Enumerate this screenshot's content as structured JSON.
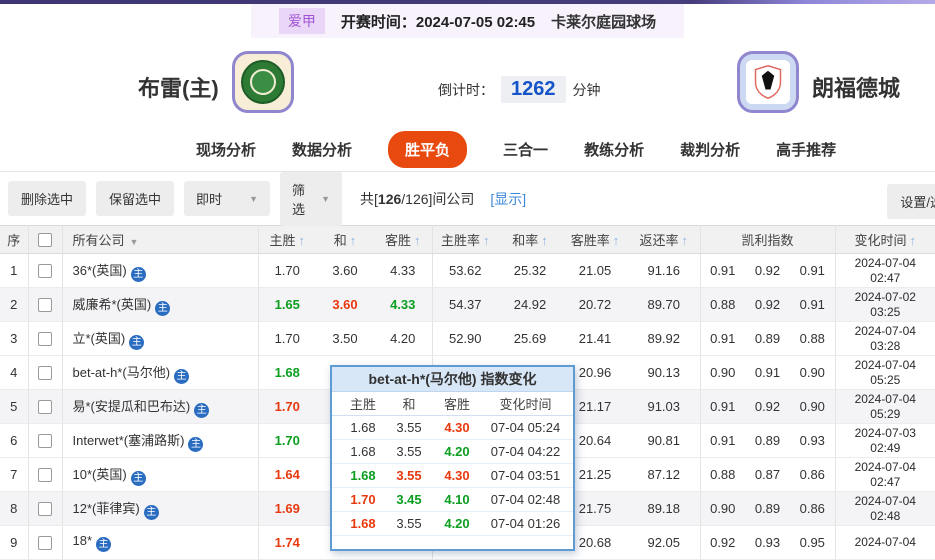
{
  "topbar": {
    "league": "爱甲",
    "kickoff": "开赛时间：2024-07-05 02:45",
    "venue": "卡莱尔庭园球场"
  },
  "header": {
    "home_team": "布雷(主)",
    "countdown_label": "倒计时：",
    "countdown_value": "1262",
    "countdown_unit": "分钟",
    "away_team": "朗福德城"
  },
  "nav": {
    "tabs": [
      {
        "id": "live",
        "label": "现场分析",
        "active": false
      },
      {
        "id": "data",
        "label": "数据分析",
        "active": false
      },
      {
        "id": "wdl",
        "label": "胜平负",
        "active": true
      },
      {
        "id": "three-in-one",
        "label": "三合一",
        "active": false
      },
      {
        "id": "coach",
        "label": "教练分析",
        "active": false
      },
      {
        "id": "referee",
        "label": "裁判分析",
        "active": false
      },
      {
        "id": "expert",
        "label": "高手推荐",
        "active": false
      }
    ]
  },
  "toolbar": {
    "delete_selected": "删除选中",
    "keep_selected": "保留选中",
    "instant_dropdown": "即时",
    "filter_dropdown": "筛选",
    "count_prefix": "共[",
    "count_bold": "126",
    "count_suffix": "/126]间公司",
    "show_link": "[显示]",
    "settings_button": "设置/选择"
  },
  "icons": {
    "sort_asc": "↑",
    "caret_down": "▼",
    "company_badge": "主"
  },
  "colors": {
    "accent_bar": "#3d3673",
    "active_tab": "#e8490f",
    "odds_rise_red": "#e8390e",
    "odds_fall_green": "#0b9e1f",
    "link_blue": "#3d87d9",
    "countdown_blue": "#1553c8",
    "popup_border_blue": "#5e9bd3"
  },
  "table": {
    "headers": {
      "seq": "序",
      "company": "所有公司",
      "home": "主胜",
      "draw": "和",
      "away": "客胜",
      "home_rate": "主胜率",
      "draw_rate": "和率",
      "away_rate": "客胜率",
      "return_rate": "返还率",
      "kelly": "凯利指数",
      "change_time": "变化时间"
    },
    "rows": [
      {
        "seq": "1",
        "company": "36*(英国)",
        "odds": [
          {
            "v": "1.70",
            "c": "k"
          },
          {
            "v": "3.60",
            "c": "k"
          },
          {
            "v": "4.33",
            "c": "k"
          }
        ],
        "rates": [
          "53.62",
          "25.32",
          "21.05",
          "91.16"
        ],
        "kelly": [
          "0.91",
          "0.92",
          "0.91"
        ],
        "date": "2024-07-04",
        "time": "02:47"
      },
      {
        "seq": "2",
        "company": "威廉希*(英国)",
        "odds": [
          {
            "v": "1.65",
            "c": "g"
          },
          {
            "v": "3.60",
            "c": "r"
          },
          {
            "v": "4.33",
            "c": "g"
          }
        ],
        "rates": [
          "54.37",
          "24.92",
          "20.72",
          "89.70"
        ],
        "kelly": [
          "0.88",
          "0.92",
          "0.91"
        ],
        "date": "2024-07-02",
        "time": "03:25"
      },
      {
        "seq": "3",
        "company": "立*(英国)",
        "odds": [
          {
            "v": "1.70",
            "c": "k"
          },
          {
            "v": "3.50",
            "c": "k"
          },
          {
            "v": "4.20",
            "c": "k"
          }
        ],
        "rates": [
          "52.90",
          "25.69",
          "21.41",
          "89.92"
        ],
        "kelly": [
          "0.91",
          "0.89",
          "0.88"
        ],
        "date": "2024-07-04",
        "time": "03:28"
      },
      {
        "seq": "4",
        "company": "bet-at-h*(马尔他)",
        "odds": [
          {
            "v": "1.68",
            "c": "g"
          },
          null,
          null
        ],
        "rates": [
          "",
          "",
          "20.96",
          "90.13"
        ],
        "kelly": [
          "0.90",
          "0.91",
          "0.90"
        ],
        "date": "2024-07-04",
        "time": "05:25"
      },
      {
        "seq": "5",
        "company": "易*(安提瓜和巴布达)",
        "odds": [
          {
            "v": "1.70",
            "c": "r"
          },
          null,
          null
        ],
        "rates": [
          "",
          "",
          "21.17",
          "91.03"
        ],
        "kelly": [
          "0.91",
          "0.92",
          "0.90"
        ],
        "date": "2024-07-04",
        "time": "05:29"
      },
      {
        "seq": "6",
        "company": "Interwet*(塞浦路斯)",
        "odds": [
          {
            "v": "1.70",
            "c": "g"
          },
          null,
          null
        ],
        "rates": [
          "",
          "",
          "20.64",
          "90.81"
        ],
        "kelly": [
          "0.91",
          "0.89",
          "0.93"
        ],
        "date": "2024-07-03",
        "time": "02:49"
      },
      {
        "seq": "7",
        "company": "10*(英国)",
        "odds": [
          {
            "v": "1.64",
            "c": "r"
          },
          null,
          null
        ],
        "rates": [
          "",
          "",
          "21.25",
          "87.12"
        ],
        "kelly": [
          "0.88",
          "0.87",
          "0.86"
        ],
        "date": "2024-07-04",
        "time": "02:47"
      },
      {
        "seq": "8",
        "company": "12*(菲律宾)",
        "odds": [
          {
            "v": "1.69",
            "c": "r"
          },
          null,
          null
        ],
        "rates": [
          "",
          "",
          "21.75",
          "89.18"
        ],
        "kelly": [
          "0.90",
          "0.89",
          "0.86"
        ],
        "date": "2024-07-04",
        "time": "02:48"
      },
      {
        "seq": "9",
        "company": "18*",
        "odds": [
          {
            "v": "1.74",
            "c": "r"
          },
          null,
          null
        ],
        "rates": [
          "",
          "",
          "20.68",
          "92.05"
        ],
        "kelly": [
          "0.92",
          "0.93",
          "0.95"
        ],
        "date": "2024-07-04",
        "time": ""
      }
    ]
  },
  "popup": {
    "title": "bet-at-h*(马尔他) 指数变化",
    "columns": {
      "home": "主胜",
      "draw": "和",
      "away": "客胜",
      "time": "变化时间"
    },
    "rows": [
      {
        "home": {
          "v": "1.68",
          "c": "k"
        },
        "draw": {
          "v": "3.55",
          "c": "k"
        },
        "away": {
          "v": "4.30",
          "c": "r"
        },
        "time": "07-04 05:24"
      },
      {
        "home": {
          "v": "1.68",
          "c": "k"
        },
        "draw": {
          "v": "3.55",
          "c": "k"
        },
        "away": {
          "v": "4.20",
          "c": "g"
        },
        "time": "07-04 04:22"
      },
      {
        "home": {
          "v": "1.68",
          "c": "g"
        },
        "draw": {
          "v": "3.55",
          "c": "r"
        },
        "away": {
          "v": "4.30",
          "c": "r"
        },
        "time": "07-04 03:51"
      },
      {
        "home": {
          "v": "1.70",
          "c": "r"
        },
        "draw": {
          "v": "3.45",
          "c": "g"
        },
        "away": {
          "v": "4.10",
          "c": "g"
        },
        "time": "07-04 02:48"
      },
      {
        "home": {
          "v": "1.68",
          "c": "r"
        },
        "draw": {
          "v": "3.55",
          "c": "k"
        },
        "away": {
          "v": "4.20",
          "c": "g"
        },
        "time": "07-04 01:26"
      }
    ]
  }
}
